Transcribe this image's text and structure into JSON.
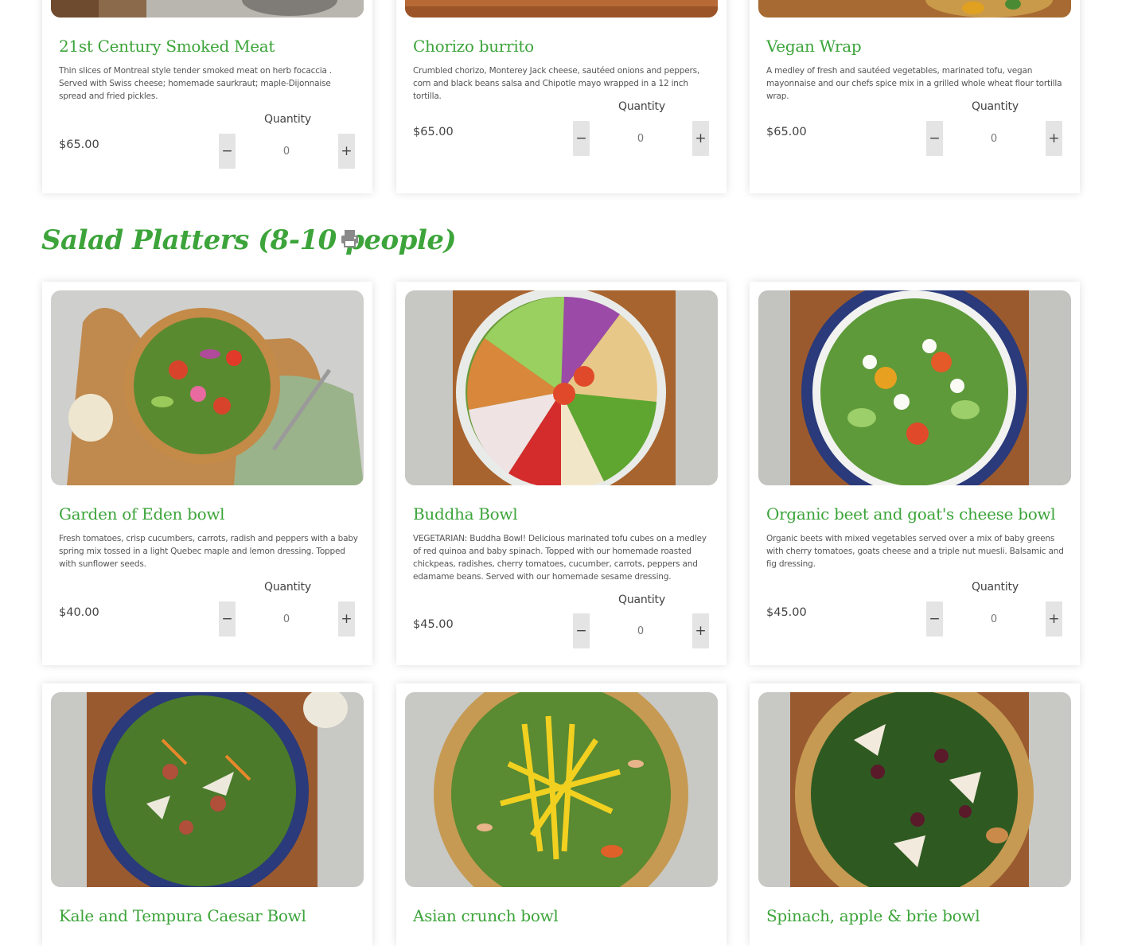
{
  "colors": {
    "accent_green": "#3ca43a",
    "card_bg": "#ffffff",
    "button_bg": "#e4e4e4"
  },
  "quantity_label": "Quantity",
  "minus_symbol": "−",
  "plus_symbol": "+",
  "top_row": [
    {
      "name": "21st Century Smoked Meat",
      "description": "Thin slices of Montreal style tender smoked meat on herb focaccia . Served with Swiss cheese; homemade saurkraut; maple-Dijonnaise spread and fried pickles.",
      "price": "$65.00",
      "quantity": "0"
    },
    {
      "name": "Chorizo burrito",
      "description": "Crumbled chorizo, Monterey Jack cheese, sautéed onions and peppers, corn and black beans salsa and Chipotle mayo wrapped in a 12 inch tortilla.",
      "price": "$65.00",
      "quantity": "0"
    },
    {
      "name": "Vegan Wrap",
      "description": "A medley of fresh and sautéed vegetables, marinated tofu, vegan mayonnaise and our chefs spice mix in a grilled whole wheat flour tortilla wrap.",
      "price": "$65.00",
      "quantity": "0"
    }
  ],
  "salad_section": {
    "title": "Salad Platters (8-10 people)",
    "print_icon": "printer-icon",
    "items": [
      {
        "name": "Garden of Eden bowl",
        "description": "Fresh tomatoes, crisp cucumbers, carrots, radish and peppers with a baby spring mix tossed in a light Quebec maple and lemon dressing. Topped with sunflower seeds.",
        "price": "$40.00",
        "quantity": "0"
      },
      {
        "name": "Buddha Bowl",
        "description": "VEGETARIAN: Buddha Bowl! Delicious marinated tofu cubes on a medley of red quinoa and baby spinach. Topped with our homemade roasted chickpeas, radishes, cherry tomatoes, cucumber, carrots, peppers and edamame beans. Served with our homemade sesame dressing.",
        "price": "$45.00",
        "quantity": "0"
      },
      {
        "name": "Organic beet and goat's cheese bowl",
        "description": "Organic beets with mixed vegetables served over a mix of baby greens with cherry tomatoes, goats cheese and a triple nut muesli. Balsamic and fig dressing.",
        "price": "$45.00",
        "quantity": "0"
      },
      {
        "name": "Kale and Tempura Caesar Bowl"
      },
      {
        "name": "Asian crunch bowl"
      },
      {
        "name": "Spinach, apple & brie bowl"
      }
    ]
  }
}
